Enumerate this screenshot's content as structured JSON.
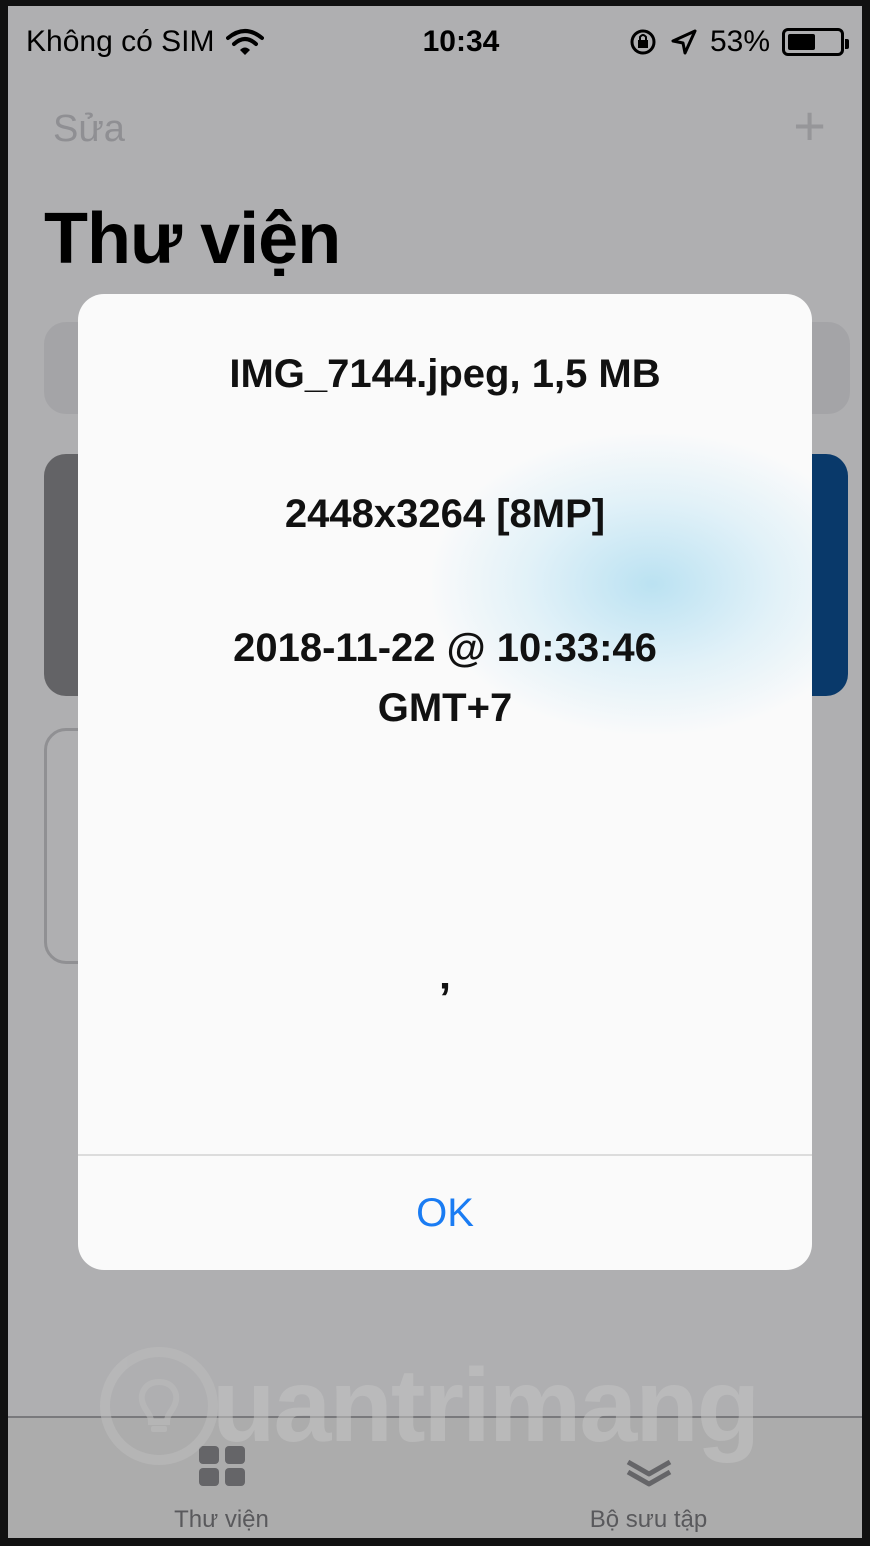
{
  "status_bar": {
    "carrier": "Không có SIM",
    "time": "10:34",
    "battery_percent": "53%",
    "battery_level": 0.53,
    "icons": [
      "wifi-icon",
      "orientation-lock-icon",
      "location-arrow-icon",
      "battery-icon"
    ]
  },
  "nav": {
    "edit_label": "Sửa",
    "add_icon": "plus-icon",
    "title": "Thư viện"
  },
  "alert": {
    "file_info": "IMG_7144.jpeg, 1,5 MB",
    "dimensions": "2448x3264 [8MP]",
    "date_line1": "2018-11-22 @ 10:33:46",
    "date_line2": "GMT+7",
    "extra": "’",
    "ok_label": "OK",
    "accent_color": "#1a7cf3"
  },
  "tabbar": {
    "tabs": [
      {
        "label": "Thư viện",
        "icon": "grid-icon"
      },
      {
        "label": "Bộ sưu tập",
        "icon": "collection-icon"
      }
    ]
  },
  "watermark": {
    "text": "uantrimang",
    "logo_icon": "lightbulb-icon"
  }
}
